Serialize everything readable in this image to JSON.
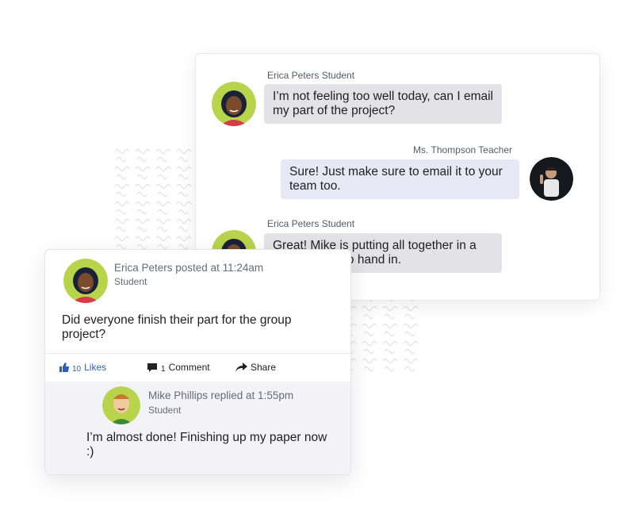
{
  "chat": {
    "messages": [
      {
        "sender": "Erica Peters Student",
        "text": "I’m not feeling too well today, can I email my part of the project?"
      },
      {
        "sender": "Ms. Thompson Teacher",
        "text": "Sure! Just make sure to email it to your team too."
      },
      {
        "sender": "Erica Peters Student",
        "text": "Great! Mike is putting all together in a presentation to hand in."
      }
    ]
  },
  "post": {
    "author_line": "Erica Peters posted at 11:24am",
    "author_role": "Student",
    "text": "Did everyone finish their part for the group project?",
    "actions": {
      "likes_count": "10",
      "likes_label": "Likes",
      "comment_count": "1",
      "comment_label": "Comment",
      "share_label": "Share"
    },
    "reply": {
      "author_line": "Mike Phillips replied at 1:55pm",
      "author_role": "Student",
      "text": "I’m almost done! Finishing up my paper now :)"
    }
  },
  "colors": {
    "accent": "#2f5fb3",
    "avatar_ring": "#9bc53d",
    "bubble_gray": "#e3e3e7",
    "bubble_blue": "#e6e8f6"
  }
}
